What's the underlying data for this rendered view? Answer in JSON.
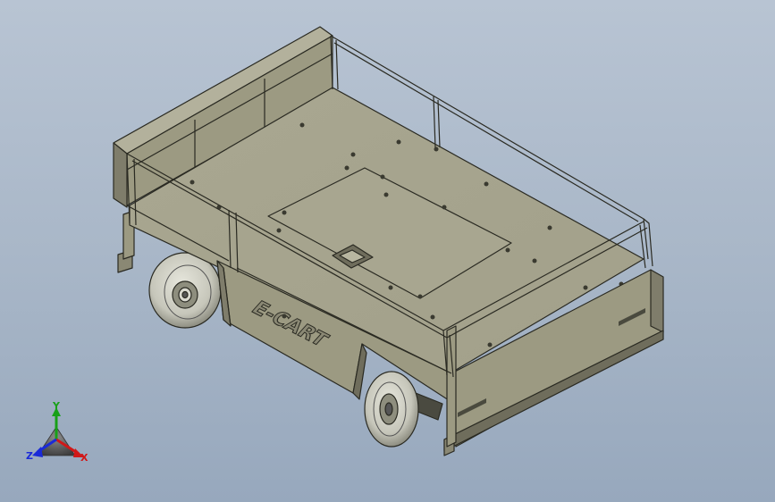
{
  "model": {
    "emboss_text": "E-CART",
    "colors": {
      "background_top": "#b8c4d3",
      "background_bottom": "#97a8bd",
      "body": "#9c9a82",
      "body_light": "#b3b19c",
      "body_dark": "#6f6d5c",
      "edge": "#2a2a22",
      "tire": "#cfcfc4"
    }
  },
  "triad": {
    "x_label": "X",
    "y_label": "Y",
    "z_label": "Z",
    "x_color": "#d01818",
    "y_color": "#18a018",
    "z_color": "#1a2ad8"
  }
}
